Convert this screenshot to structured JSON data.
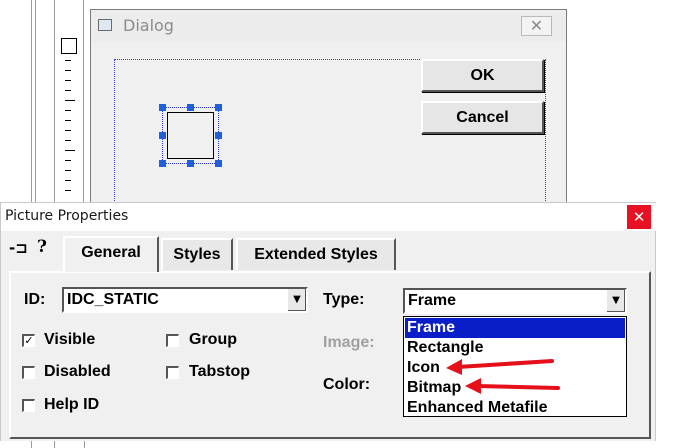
{
  "dialog": {
    "title": "Dialog",
    "ok_label": "OK",
    "cancel_label": "Cancel",
    "close_glyph": "✕"
  },
  "properties": {
    "title": "Picture Properties",
    "close_glyph": "✕",
    "pin_glyph": "-⊐",
    "help_glyph": "?",
    "tabs": [
      {
        "label": "General",
        "active": true
      },
      {
        "label": "Styles",
        "active": false
      },
      {
        "label": "Extended Styles",
        "active": false
      }
    ],
    "id_label": "ID:",
    "id_value": "IDC_STATIC",
    "type_label": "Type:",
    "type_value": "Frame",
    "image_label": "Image:",
    "color_label": "Color:",
    "checkboxes": [
      {
        "label": "Visible",
        "checked": true
      },
      {
        "label": "Disabled",
        "checked": false
      },
      {
        "label": "Help ID",
        "checked": false
      },
      {
        "label": "Group",
        "checked": false
      },
      {
        "label": "Tabstop",
        "checked": false
      }
    ],
    "type_options": [
      "Frame",
      "Rectangle",
      "Icon",
      "Bitmap",
      "Enhanced Metafile"
    ],
    "selected_option": "Frame"
  },
  "annotation": {
    "arrow_color": "#e5101a",
    "highlighted_options": [
      "Icon",
      "Bitmap"
    ]
  },
  "colors": {
    "selection": "#0a1ec8",
    "close_red": "#e81123",
    "dialog_title_text": "#8c8c8c"
  }
}
